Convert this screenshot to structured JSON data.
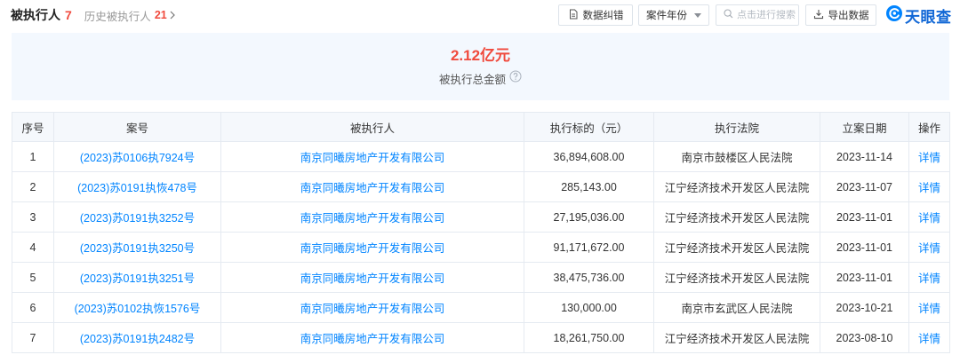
{
  "header": {
    "title": "被执行人",
    "count": "7",
    "history_label": "历史被执行人",
    "history_count": "21",
    "history_icon": "chevron-right-icon"
  },
  "toolbar": {
    "correct_button": {
      "label": "数据纠错",
      "icon": "document-icon"
    },
    "year_filter": {
      "label": "案件年份",
      "icon": "caret-down-icon"
    },
    "search": {
      "placeholder": "点击进行搜索",
      "value": "",
      "icon": "search-icon"
    },
    "export_button": {
      "label": "导出数据",
      "icon": "download-icon"
    },
    "logo": {
      "text": "天眼查",
      "icon": "tianyancha-logo-icon"
    }
  },
  "summary": {
    "amount": "2.12亿元",
    "label": "被执行总金额",
    "help_icon": "question-circle-icon"
  },
  "table": {
    "columns": [
      "序号",
      "案号",
      "被执行人",
      "执行标的（元）",
      "执行法院",
      "立案日期",
      "操作"
    ],
    "rows": [
      {
        "index": "1",
        "case_no": "(2023)苏0106执7924号",
        "executee": "南京同曦房地产开发有限公司",
        "amount": "36,894,608.00",
        "court": "南京市鼓楼区人民法院",
        "date": "2023-11-14",
        "action": "详情"
      },
      {
        "index": "2",
        "case_no": "(2023)苏0191执恢478号",
        "executee": "南京同曦房地产开发有限公司",
        "amount": "285,143.00",
        "court": "江宁经济技术开发区人民法院",
        "date": "2023-11-07",
        "action": "详情"
      },
      {
        "index": "3",
        "case_no": "(2023)苏0191执3252号",
        "executee": "南京同曦房地产开发有限公司",
        "amount": "27,195,036.00",
        "court": "江宁经济技术开发区人民法院",
        "date": "2023-11-01",
        "action": "详情"
      },
      {
        "index": "4",
        "case_no": "(2023)苏0191执3250号",
        "executee": "南京同曦房地产开发有限公司",
        "amount": "91,171,672.00",
        "court": "江宁经济技术开发区人民法院",
        "date": "2023-11-01",
        "action": "详情"
      },
      {
        "index": "5",
        "case_no": "(2023)苏0191执3251号",
        "executee": "南京同曦房地产开发有限公司",
        "amount": "38,475,736.00",
        "court": "江宁经济技术开发区人民法院",
        "date": "2023-11-01",
        "action": "详情"
      },
      {
        "index": "6",
        "case_no": "(2023)苏0102执恢1576号",
        "executee": "南京同曦房地产开发有限公司",
        "amount": "130,000.00",
        "court": "南京市玄武区人民法院",
        "date": "2023-10-21",
        "action": "详情"
      },
      {
        "index": "7",
        "case_no": "(2023)苏0191执2482号",
        "executee": "南京同曦房地产开发有限公司",
        "amount": "18,261,750.00",
        "court": "江宁经济技术开发区人民法院",
        "date": "2023-08-10",
        "action": "详情"
      }
    ]
  },
  "colors": {
    "accent": "#0084ff",
    "highlight": "#f04a3d",
    "summary_bg": "#f3f8fe",
    "header_bg": "#f5f8fc",
    "border": "#e5eaf1"
  }
}
